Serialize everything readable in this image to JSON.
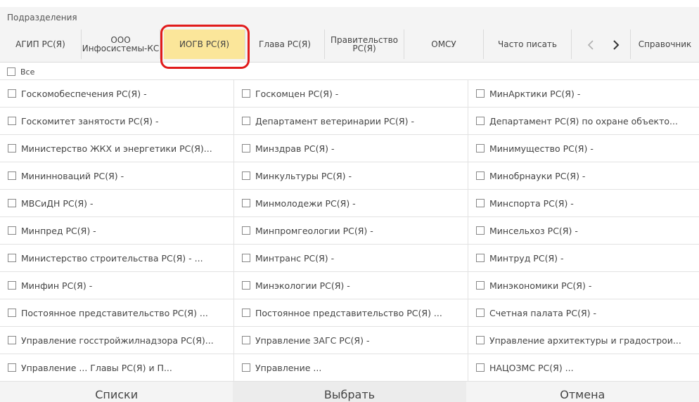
{
  "header": {
    "title": "Подразделения"
  },
  "tabs": [
    {
      "label": "АГИП РС(Я)"
    },
    {
      "label": "ООО Инфосистемы-КС"
    },
    {
      "label": "ИОГВ РС(Я)"
    },
    {
      "label": "Глава РС(Я)"
    },
    {
      "label": "Правительство РС(Я)"
    },
    {
      "label": "ОМСУ"
    },
    {
      "label": "Часто писать"
    },
    {
      "label": "Справочник"
    }
  ],
  "tab_lines": {
    "ooo_1": "ООО",
    "ooo_2": "Инфосистемы-КС",
    "gov_1": "Правительство",
    "gov_2": "РС(Я)"
  },
  "all_label": "Все",
  "rows": [
    [
      "Госкомобеспечения РС(Я) -",
      "Госкомцен РС(Я) -",
      "МинАрктики РС(Я) -"
    ],
    [
      "Госкомитет занятости РС(Я) -",
      "Департамент ветеринарии РС(Я) -",
      "Департамент РС(Я) по охране объекто..."
    ],
    [
      "Министерство ЖКХ и энергетики РС(Я)...",
      "Минздрав РС(Я) -",
      "Минимущество РС(Я) -"
    ],
    [
      "Мининноваций РС(Я) -",
      "Минкультуры РС(Я) -",
      "Минобрнауки РС(Я) -"
    ],
    [
      "МВСиДН РС(Я) -",
      "Минмолодежи РС(Я) -",
      "Минспорта РС(Я) -"
    ],
    [
      "Минпред РС(Я) -",
      "Минпромгеологии РС(Я) -",
      "Минсельхоз РС(Я) -"
    ],
    [
      "Министерство строительства РС(Я) - ...",
      "Минтранс РС(Я) -",
      "Минтруд РС(Я) -"
    ],
    [
      "Минфин РС(Я) -",
      "Минэкологии РС(Я) -",
      "Минэкономики РС(Я) -"
    ],
    [
      "Постоянное представительство РС(Я) ...",
      "Постоянное представительство РС(Я) ...",
      "Счетная палата РС(Я) -"
    ],
    [
      "Управление госстройжилнадзора РС(Я)...",
      "Управление ЗАГС РС(Я) -",
      "Управление архитектуры и градострои..."
    ],
    [
      "Управление ... Главы РС(Я) и П...",
      "Управление ...",
      "НАЦОЗМС РС(Я) ..."
    ]
  ],
  "footer": {
    "lists": "Списки",
    "select": "Выбрать",
    "cancel": "Отмена"
  },
  "colors": {
    "active_tab": "#fbe69a",
    "highlight": "#e11b1b",
    "header_bg": "#f4f4f4"
  }
}
